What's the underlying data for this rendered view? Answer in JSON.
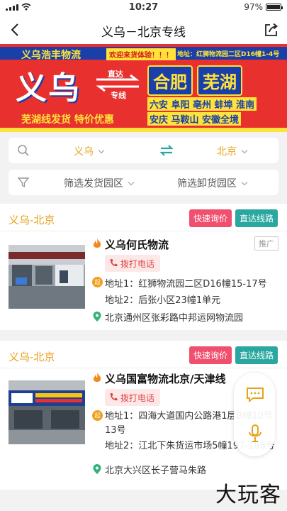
{
  "status_bar": {
    "time": "10:27",
    "battery": "97%"
  },
  "nav": {
    "title": "义乌－北京专线"
  },
  "banner": {
    "company": "义乌浩丰物流",
    "welcome": "欢迎来货体验！！！",
    "address": "地址：红狮物流园二区D16幢1-4号",
    "origin": "义乌",
    "arrow_top": "直达",
    "arrow_bottom": "专线",
    "destinations": [
      "合肥",
      "芜湖"
    ],
    "cities_line1": "六安 阜阳 亳州 蚌埠 淮南",
    "cities_line2": "安庆 马鞍山  安徽全境",
    "slogan": "芜湖线发货 特价优惠",
    "colors": {
      "red": "#e8302f",
      "blue": "#1a3fa8",
      "yellow": "#ffe23a"
    }
  },
  "route_filter": {
    "from": "义乌",
    "to": "北京"
  },
  "park_filter": {
    "from_label": "筛选发货园区",
    "to_label": "筛选卸货园区"
  },
  "listings": [
    {
      "route": "义乌-北京",
      "inquiry_label": "快速询价",
      "direct_label": "直达线路",
      "company": "义乌何氏物流",
      "promo": "推广",
      "call_label": "拨打电话",
      "badge": "起",
      "address1": "地址1：红狮物流园二区D16幢15-17号",
      "address2": "地址2：后张小区23幢1单元",
      "destination": "北京通州区张彩路中邦运网物流园"
    },
    {
      "route": "义乌-北京",
      "inquiry_label": "快速询价",
      "direct_label": "直达线路",
      "company": "义乌国富物流北京/天津线",
      "call_label": "拨打电话",
      "badge": "起",
      "address1": "地址1：四海大道国内公路港1层B幢10号13号",
      "address2": "地址2：江北下朱货运市场5幢197-198号",
      "destination": "北京大兴区长子营马朱路"
    }
  ],
  "watermark": "大玩客",
  "theme": {
    "accent": "#e8a21a",
    "pink": "#f0506e",
    "teal": "#2aa7a0"
  }
}
